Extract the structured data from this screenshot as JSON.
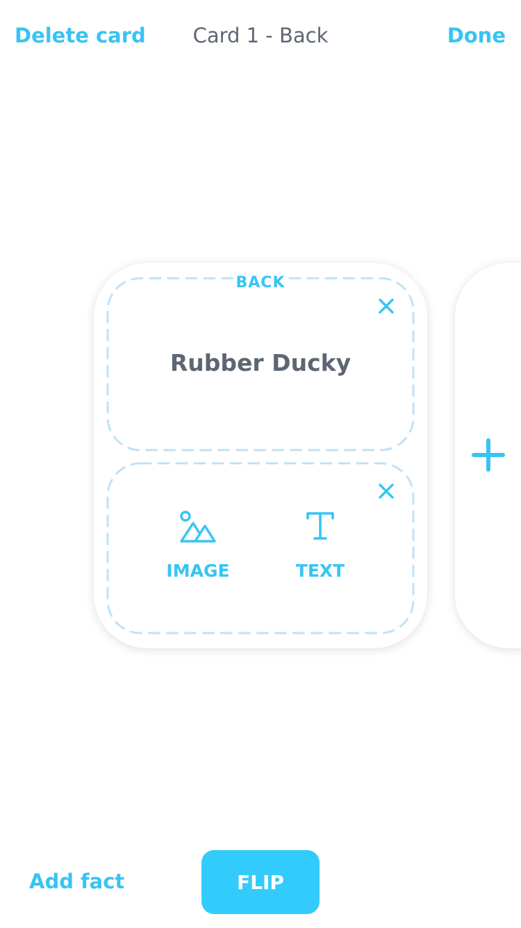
{
  "topbar": {
    "left_action": "Delete card",
    "title": "Card 1 - Back",
    "right_action": "Done"
  },
  "card": {
    "side_label": "BACK",
    "slots": [
      {
        "type": "text",
        "content": "Rubber Ducky"
      },
      {
        "type": "empty",
        "options": [
          {
            "icon": "image-icon",
            "label": "IMAGE"
          },
          {
            "icon": "text-icon",
            "label": "TEXT"
          }
        ]
      }
    ]
  },
  "next_card": {
    "icon": "plus-icon"
  },
  "bottombar": {
    "add_fact_label": "Add fact",
    "flip_label": "FLIP"
  },
  "colors": {
    "accent": "#37c4f4",
    "button": "#33cbfb",
    "text": "#5d6673",
    "dash": "#bfe2f7"
  }
}
